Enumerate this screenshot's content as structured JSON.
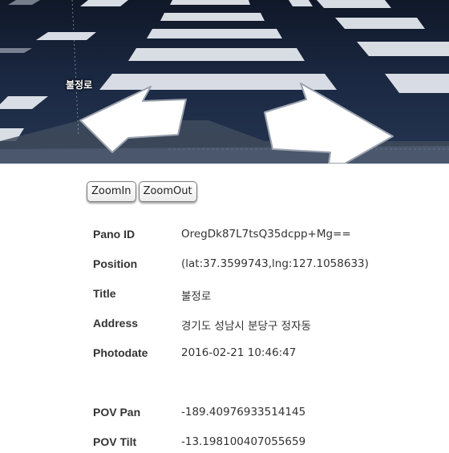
{
  "streetview": {
    "road_label": "불정로",
    "arrows": [
      "nav-arrow-left",
      "nav-arrow-right"
    ]
  },
  "controls": {
    "zoom_in_label": "ZoomIn",
    "zoom_out_label": "ZoomOut"
  },
  "info": [
    {
      "label": "Pano ID",
      "value": "OregDk87L7tsQ35dcpp+Mg=="
    },
    {
      "label": "Position",
      "value": "(lat:37.3599743,lng:127.1058633)"
    },
    {
      "label": "Title",
      "value": "불정로"
    },
    {
      "label": "Address",
      "value": "경기도 성남시 분당구 정자동"
    },
    {
      "label": "Photodate",
      "value": "2016-02-21 10:46:47"
    },
    {
      "label": "POV Pan",
      "value": "-189.40976933514145"
    },
    {
      "label": "POV Tilt",
      "value": "-13.198100407055659"
    }
  ]
}
